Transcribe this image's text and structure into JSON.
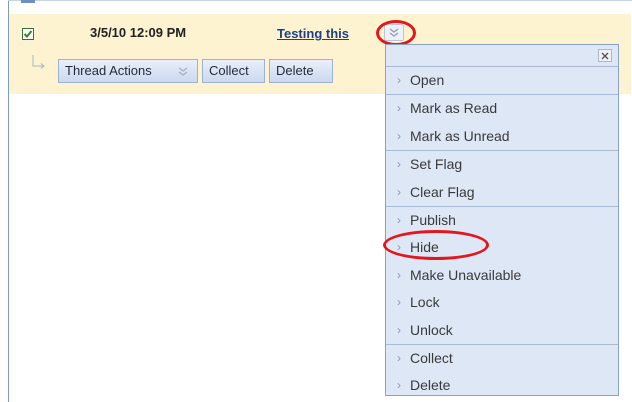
{
  "row": {
    "selected": true,
    "date": "3/5/10 12:09 PM",
    "subject": "Testing this"
  },
  "actions": {
    "thread_actions": "Thread Actions",
    "collect": "Collect",
    "delete": "Delete"
  },
  "menu": {
    "close_icon": "close-icon",
    "groups": [
      [
        "Open"
      ],
      [
        "Mark as Read",
        "Mark as Unread"
      ],
      [
        "Set Flag",
        "Clear Flag"
      ],
      [
        "Publish",
        "Hide",
        "Make Unavailable",
        "Lock",
        "Unlock"
      ],
      [
        "Collect",
        "Delete"
      ]
    ]
  },
  "colors": {
    "row_highlight": "#fdf3d0",
    "menu_bg": "#dde7f6",
    "annotation": "#e3161c",
    "link": "#1f3f8a"
  }
}
